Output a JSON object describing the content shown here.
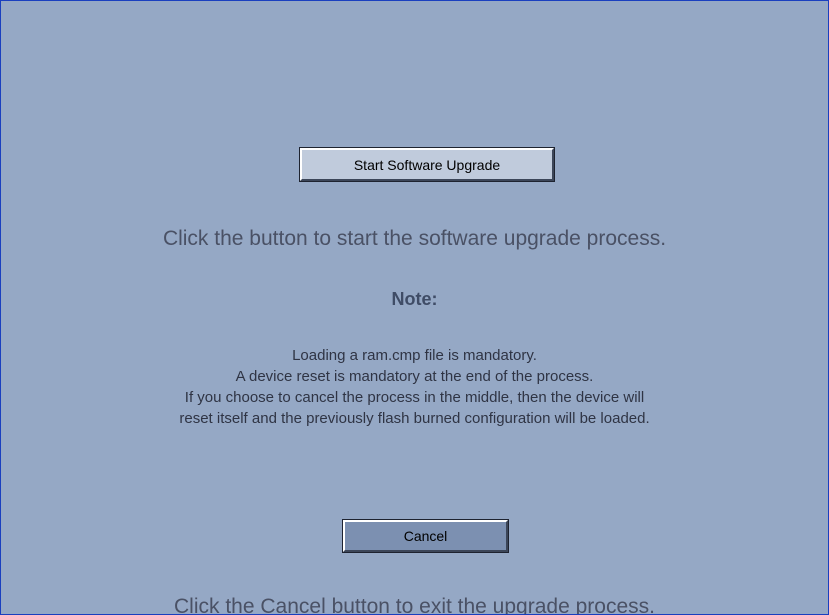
{
  "start_button_label": "Start Software Upgrade",
  "start_instruction": "Click the button to start the software upgrade process.",
  "note": {
    "title": "Note:",
    "lines": [
      "Loading a ram.cmp file is mandatory.",
      "A device reset is mandatory at the end of the process.",
      "If you choose to cancel the process in the middle, then the device will",
      "reset itself and the previously flash burned configuration will be loaded."
    ]
  },
  "cancel_button_label": "Cancel",
  "cancel_instruction": "Click the Cancel button to exit the upgrade process.",
  "colors": {
    "background": "#95a8c5",
    "frame_border": "#1a3fbf",
    "start_button_face": "#c0cbdc",
    "cancel_button_face": "#7c90b1"
  }
}
